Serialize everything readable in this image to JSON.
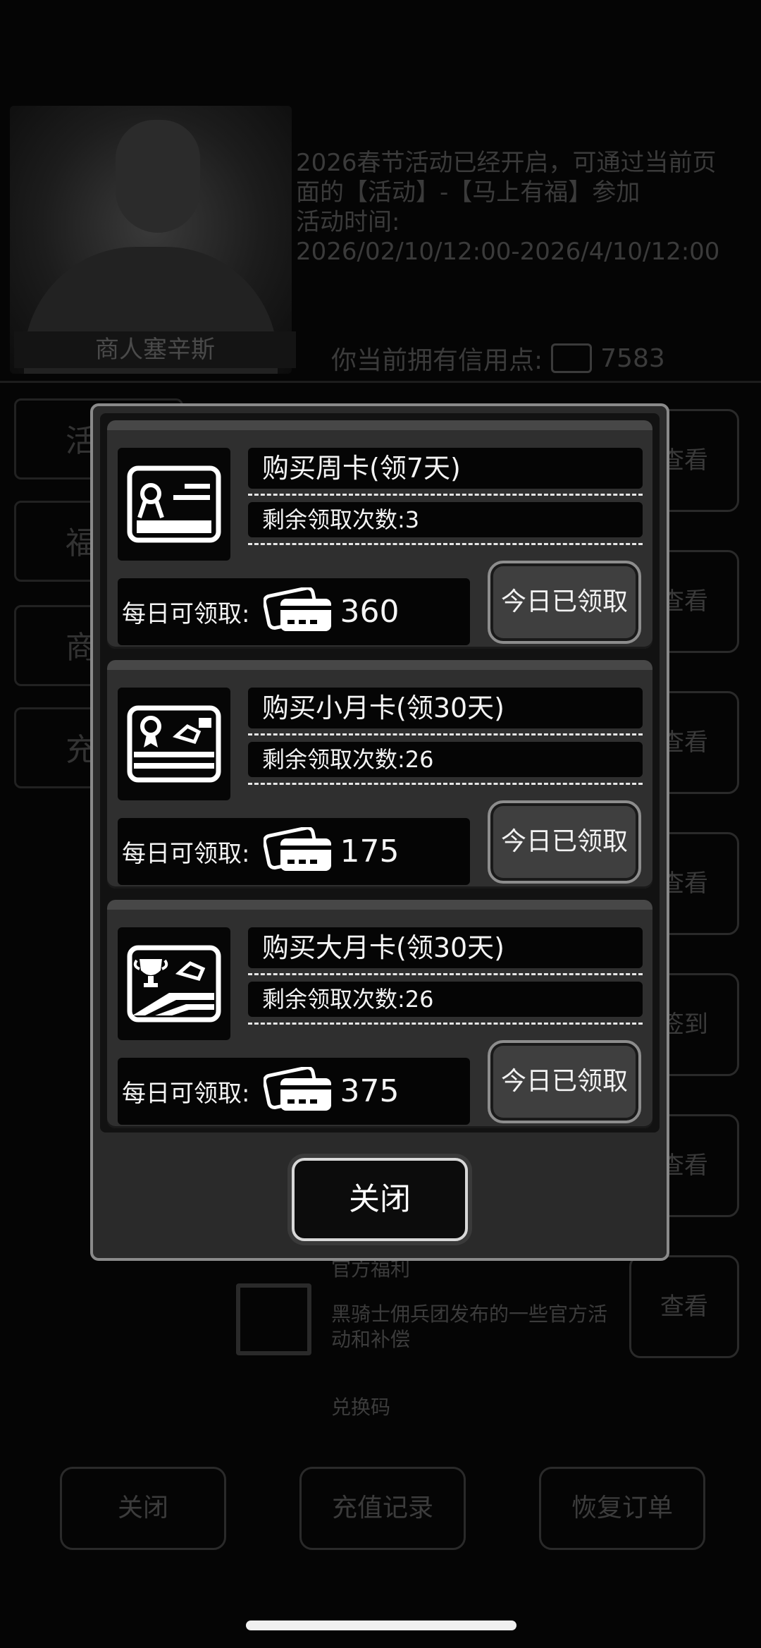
{
  "background": {
    "merchant_name": "商人塞辛斯",
    "notice_line1": "2026春节活动已经开启，可通过当前页",
    "notice_line2": "面的【活动】-【马上有福】参加",
    "notice_line3": "活动时间:",
    "notice_line4": "2026/02/10/12:00-2026/4/10/12:00",
    "credit_label": "你当前拥有信用点:",
    "credit_value": "7583",
    "tabs": [
      "活",
      "福",
      "商",
      "充"
    ],
    "side_buttons": [
      "查看",
      "查看",
      "查看",
      "查看",
      "签到",
      "查看",
      "查看"
    ],
    "official_title": "官方福利",
    "official_desc1": "黑骑士佣兵团发布的一些官方活",
    "official_desc2": "动和补偿",
    "redeem_title": "兑换码",
    "bottom_buttons": [
      "关闭",
      "充值记录",
      "恢复订单"
    ]
  },
  "modal": {
    "cards": [
      {
        "icon": "ribbon-card-icon",
        "title": "购买周卡(领7天)",
        "remaining": "剩余领取次数:3",
        "daily_label": "每日可领取:",
        "daily_amount": "360",
        "button": "今日已领取"
      },
      {
        "icon": "medal-card-icon",
        "title": "购买小月卡(领30天)",
        "remaining": "剩余领取次数:26",
        "daily_label": "每日可领取:",
        "daily_amount": "175",
        "button": "今日已领取"
      },
      {
        "icon": "trophy-card-icon",
        "title": "购买大月卡(领30天)",
        "remaining": "剩余领取次数:26",
        "daily_label": "每日可领取:",
        "daily_amount": "375",
        "button": "今日已领取"
      }
    ],
    "close_label": "关闭"
  }
}
